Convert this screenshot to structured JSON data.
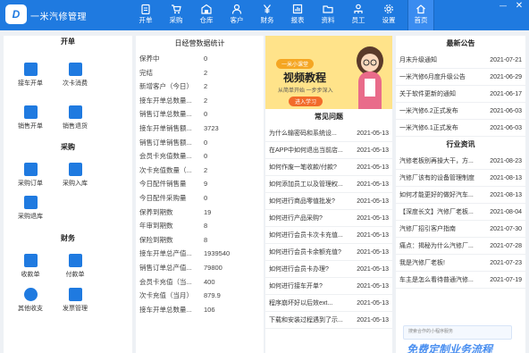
{
  "app": {
    "title": "一米汽修管理",
    "logo": "D"
  },
  "nav": [
    {
      "label": "开单",
      "icon": "clipboard-icon"
    },
    {
      "label": "采购",
      "icon": "cart-icon"
    },
    {
      "label": "仓库",
      "icon": "warehouse-icon"
    },
    {
      "label": "客户",
      "icon": "person-icon"
    },
    {
      "label": "财务",
      "icon": "yen-icon"
    },
    {
      "label": "报表",
      "icon": "chart-icon"
    },
    {
      "label": "资料",
      "icon": "folder-icon"
    },
    {
      "label": "员工",
      "icon": "staff-icon"
    },
    {
      "label": "设置",
      "icon": "gear-icon"
    },
    {
      "label": "首页",
      "icon": "home-icon"
    }
  ],
  "left": {
    "kaidan": {
      "title": "开单",
      "items": [
        {
          "label": "接车开单"
        },
        {
          "label": "次卡消费"
        },
        {
          "label": "销售开单"
        },
        {
          "label": "销售退货"
        }
      ]
    },
    "caigou": {
      "title": "采购",
      "items": [
        {
          "label": "采购订单"
        },
        {
          "label": "采购入库"
        },
        {
          "label": "采购退库"
        }
      ]
    },
    "caiwu": {
      "title": "财务",
      "items": [
        {
          "label": "收款单"
        },
        {
          "label": "付款单"
        },
        {
          "label": "其他收支"
        },
        {
          "label": "发票管理"
        }
      ]
    }
  },
  "stats": {
    "title": "日经营数据统计",
    "rows": [
      {
        "label": "保养中",
        "value": "0"
      },
      {
        "label": "完结",
        "value": "2"
      },
      {
        "label": "新增客户（今日）",
        "value": "2"
      },
      {
        "label": "接车开单总数量...",
        "value": "2"
      },
      {
        "label": "销售订单总数量...",
        "value": "0"
      },
      {
        "label": "接车开单销售额...",
        "value": "3723"
      },
      {
        "label": "销售订单销售额...",
        "value": "0"
      },
      {
        "label": "会员卡充值数量...",
        "value": "0"
      },
      {
        "label": "次卡充值数量（...",
        "value": "2"
      },
      {
        "label": "今日配件销售量",
        "value": "9"
      },
      {
        "label": "今日配件采购量",
        "value": "0"
      },
      {
        "label": "保养到期数",
        "value": "19"
      },
      {
        "label": "年审到期数",
        "value": "8"
      },
      {
        "label": "保险到期数",
        "value": "8"
      },
      {
        "label": "接车开单总产值...",
        "value": "1939540"
      },
      {
        "label": "销售订单总产值...",
        "value": "79800"
      },
      {
        "label": "会员卡充值（当...",
        "value": "400"
      },
      {
        "label": "次卡充值（当月）",
        "value": "879.9"
      },
      {
        "label": "接车开单总数量...",
        "value": "106"
      }
    ]
  },
  "banner": {
    "tag": "一米小课堂",
    "title": "视频教程",
    "subtitle": "从简单开始 一步步深入",
    "button": "进入学习"
  },
  "faq": {
    "title": "常见问题",
    "items": [
      {
        "text": "为什么输密码和系统设...",
        "date": "2021-05-13"
      },
      {
        "text": "在APP中如何退出当前店...",
        "date": "2021-05-13"
      },
      {
        "text": "如何作废一笔收款/付款?",
        "date": "2021-05-13"
      },
      {
        "text": "如何添加员工以及管理权...",
        "date": "2021-05-13"
      },
      {
        "text": "如何进行商品零值批发?",
        "date": "2021-05-13"
      },
      {
        "text": "如何进行产品采购?",
        "date": "2021-05-13"
      },
      {
        "text": "如何进行会员卡次卡充值...",
        "date": "2021-05-13"
      },
      {
        "text": "如何进行会员卡余额充值?",
        "date": "2021-05-13"
      },
      {
        "text": "如何进行会员卡办理?",
        "date": "2021-05-13"
      },
      {
        "text": "如何进行接车开单?",
        "date": "2021-05-13"
      },
      {
        "text": "程序崩坏好以后效ext...",
        "date": "2021-05-13"
      },
      {
        "text": "下载和安装过程遇到了示...",
        "date": "2021-05-13"
      }
    ]
  },
  "notices": {
    "title": "最新公告",
    "items": [
      {
        "text": "月末升级通知",
        "date": "2021-07-21"
      },
      {
        "text": "一米汽修6月度升级公告",
        "date": "2021-06-29"
      },
      {
        "text": "关于软件更新的通知",
        "date": "2021-06-17"
      },
      {
        "text": "一米汽修6.2正式发布",
        "date": "2021-06-03"
      },
      {
        "text": "一米汽修6.1正式发布",
        "date": "2021-06-03"
      }
    ]
  },
  "news": {
    "title": "行业资讯",
    "items": [
      {
        "text": "汽修老板别再操大干，方...",
        "date": "2021-08-23"
      },
      {
        "text": "汽修厂该有的设备管理制度",
        "date": "2021-08-13"
      },
      {
        "text": "如何才能更好的做好汽车...",
        "date": "2021-08-13"
      },
      {
        "text": "【深度长文】汽修厂老板...",
        "date": "2021-08-04"
      },
      {
        "text": "汽修厂招引客户指南",
        "date": "2021-07-30"
      },
      {
        "text": "痛点：揭秘为什么汽修厂...",
        "date": "2021-07-28"
      },
      {
        "text": "我是汽修厂老板!",
        "date": "2021-07-23"
      },
      {
        "text": "车主是怎么看待普通汽修...",
        "date": "2021-07-19"
      }
    ]
  },
  "promo": {
    "small": "搜索合作的小程序服务",
    "big": "免费定制业务流程"
  },
  "window": {
    "minimize": "—",
    "close": "✕"
  },
  "colors": {
    "primary": "#1f7ae0",
    "banner": "#ffe38a",
    "accent": "#f26b2a"
  }
}
